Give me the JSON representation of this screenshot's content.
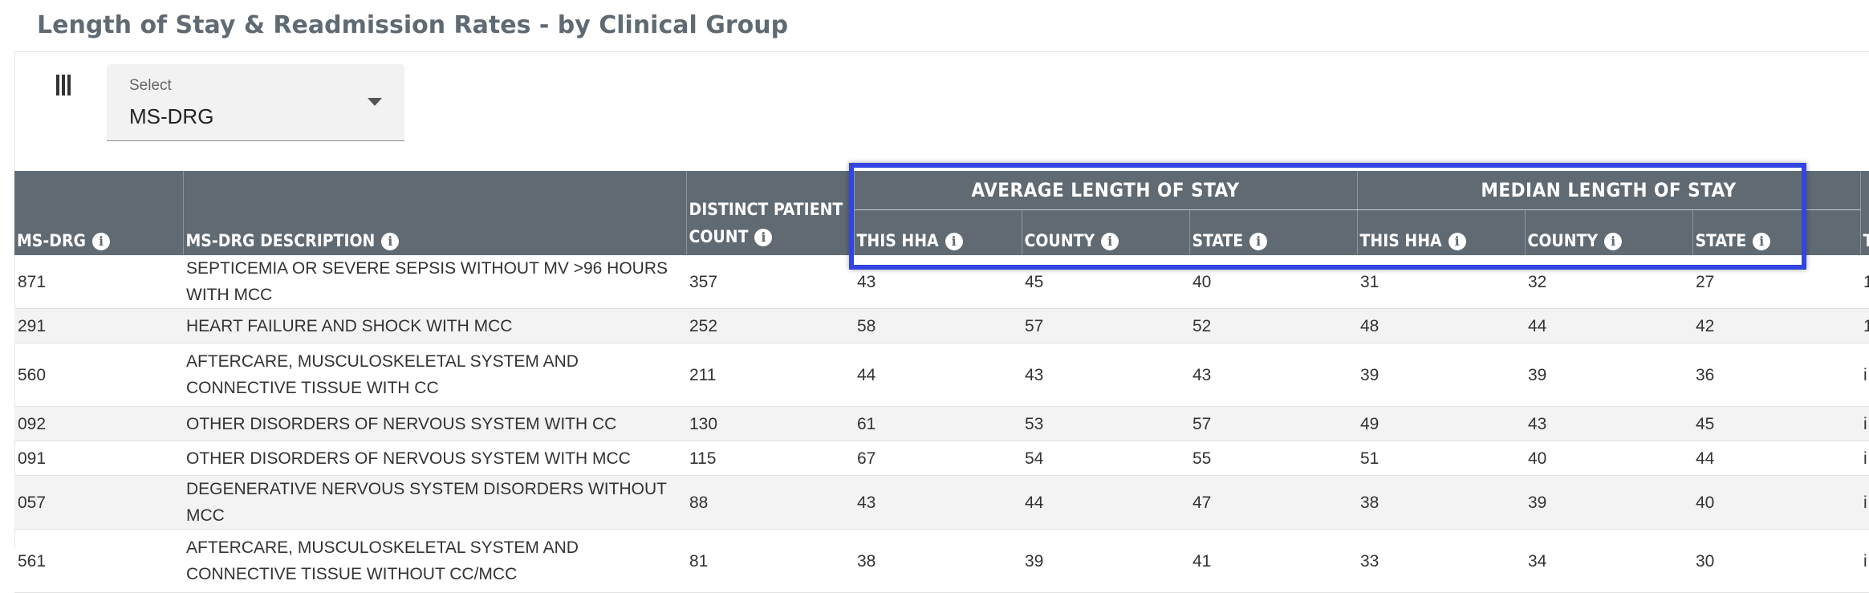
{
  "page": {
    "title": "Length of Stay & Readmission Rates - by Clinical Group"
  },
  "icons": {
    "columns": "column-view-icon",
    "info": "info-icon"
  },
  "select": {
    "label": "Select",
    "value": "MS-DRG"
  },
  "table": {
    "headers": {
      "msdrg": "MS-DRG",
      "description": "MS-DRG DESCRIPTION",
      "count_line1": "DISTINCT PATIENT",
      "count_line2": "COUNT",
      "avg_group": "AVERAGE LENGTH OF STAY",
      "median_group": "MEDIAN LENGTH OF STAY",
      "this_hha": "THIS HHA",
      "county": "COUNTY",
      "state": "STATE",
      "cut_off": "T"
    },
    "rows": [
      {
        "drg": "871",
        "desc": "SEPTICEMIA OR SEVERE SEPSIS WITHOUT MV >96 HOURS WITH MCC",
        "count": "357",
        "avg_hha": "43",
        "avg_county": "45",
        "avg_state": "40",
        "med_hha": "31",
        "med_county": "32",
        "med_state": "27",
        "extra": "1"
      },
      {
        "drg": "291",
        "desc": "HEART FAILURE AND SHOCK WITH MCC",
        "count": "252",
        "avg_hha": "58",
        "avg_county": "57",
        "avg_state": "52",
        "med_hha": "48",
        "med_county": "44",
        "med_state": "42",
        "extra": "1"
      },
      {
        "drg": "560",
        "desc": "AFTERCARE, MUSCULOSKELETAL SYSTEM AND CONNECTIVE TISSUE WITH CC",
        "count": "211",
        "avg_hha": "44",
        "avg_county": "43",
        "avg_state": "43",
        "med_hha": "39",
        "med_county": "39",
        "med_state": "36",
        "extra": "i"
      },
      {
        "drg": "092",
        "desc": "OTHER DISORDERS OF NERVOUS SYSTEM WITH CC",
        "count": "130",
        "avg_hha": "61",
        "avg_county": "53",
        "avg_state": "57",
        "med_hha": "49",
        "med_county": "43",
        "med_state": "45",
        "extra": "i"
      },
      {
        "drg": "091",
        "desc": "OTHER DISORDERS OF NERVOUS SYSTEM WITH MCC",
        "count": "115",
        "avg_hha": "67",
        "avg_county": "54",
        "avg_state": "55",
        "med_hha": "51",
        "med_county": "40",
        "med_state": "44",
        "extra": "i"
      },
      {
        "drg": "057",
        "desc": "DEGENERATIVE NERVOUS SYSTEM DISORDERS WITHOUT MCC",
        "count": "88",
        "avg_hha": "43",
        "avg_county": "44",
        "avg_state": "47",
        "med_hha": "38",
        "med_county": "39",
        "med_state": "40",
        "extra": "i"
      },
      {
        "drg": "561",
        "desc": "AFTERCARE, MUSCULOSKELETAL SYSTEM AND CONNECTIVE TISSUE WITHOUT CC/MCC",
        "count": "81",
        "avg_hha": "38",
        "avg_county": "39",
        "avg_state": "41",
        "med_hha": "33",
        "med_county": "34",
        "med_state": "30",
        "extra": "i"
      }
    ]
  },
  "colors": {
    "header_bg": "#5f6a73",
    "highlight": "#3345e0",
    "row_alt": "#f3f3f3"
  }
}
